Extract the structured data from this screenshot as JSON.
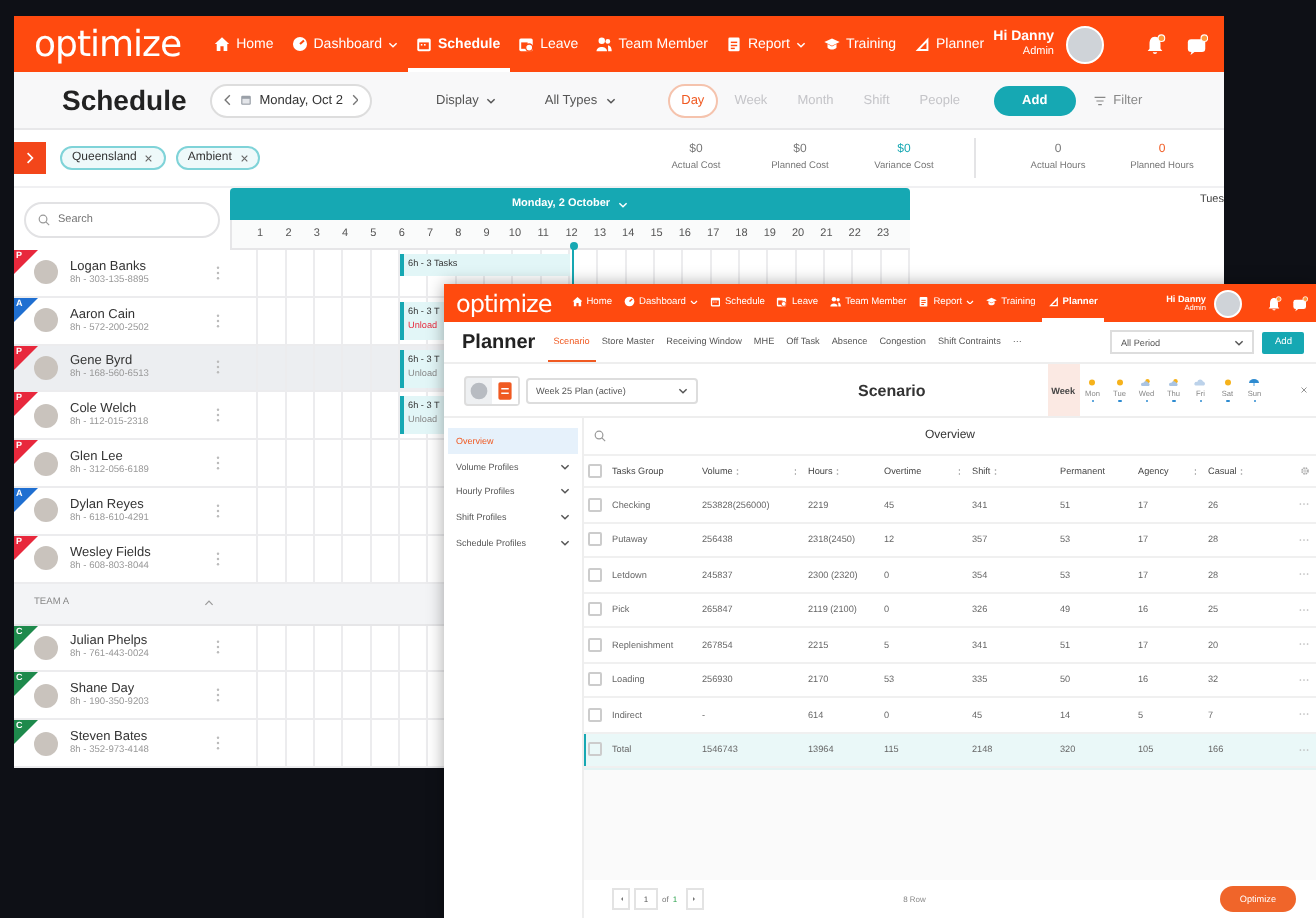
{
  "schedule_window": {
    "nav": {
      "logo": "optimize",
      "items": [
        {
          "label": "Home",
          "kind": "home",
          "dropdown": false,
          "selected": false
        },
        {
          "label": "Dashboard",
          "kind": "dashboard",
          "dropdown": true,
          "selected": false
        },
        {
          "label": "Schedule",
          "kind": "schedule",
          "dropdown": false,
          "selected": true
        },
        {
          "label": "Leave",
          "kind": "leave",
          "dropdown": false,
          "selected": false
        },
        {
          "label": "Team Member",
          "kind": "team",
          "dropdown": false,
          "selected": false
        },
        {
          "label": "Report",
          "kind": "report",
          "dropdown": true,
          "selected": false
        },
        {
          "label": "Training",
          "kind": "training",
          "dropdown": false,
          "selected": false
        },
        {
          "label": "Planner",
          "kind": "planner",
          "dropdown": false,
          "selected": false
        }
      ],
      "user": {
        "greeting": "Hi Danny",
        "role": "Admin"
      }
    },
    "title": "Schedule",
    "date": "Monday, Oct 2",
    "display": "Display",
    "types": "All Types",
    "views": [
      {
        "label": "Day",
        "selected": true
      },
      {
        "label": "Week",
        "selected": false
      },
      {
        "label": "Month",
        "selected": false
      },
      {
        "label": "Shift",
        "selected": false
      },
      {
        "label": "People",
        "selected": false
      }
    ],
    "add": "Add",
    "filter": "Filter",
    "chips": [
      "Queensland",
      "Ambient"
    ],
    "stats": [
      {
        "value": "$0",
        "label": "Actual Cost",
        "kind": "plain"
      },
      {
        "value": "$0",
        "label": "Planned Cost",
        "kind": "plain"
      },
      {
        "value": "$0",
        "label": "Variance Cost",
        "kind": "accent"
      },
      {
        "value": "0",
        "label": "Actual Hours",
        "kind": "plain"
      },
      {
        "value": "0",
        "label": "Planned Hours",
        "kind": "warning"
      }
    ],
    "search": {
      "placeholder": "Search"
    },
    "day_header": "Monday, 2 October",
    "next_day": "Tues",
    "hours": [
      "1",
      "2",
      "3",
      "4",
      "5",
      "6",
      "7",
      "8",
      "9",
      "10",
      "11",
      "12",
      "13",
      "14",
      "15",
      "16",
      "17",
      "18",
      "19",
      "20",
      "21",
      "22",
      "23"
    ],
    "people": [
      {
        "kind": "person",
        "name": "Logan Banks",
        "info": "8h - 303-135-8895",
        "badge": "P",
        "color": "#e8283c",
        "selected": false,
        "task": {
          "title": "6h - 3 Tasks"
        }
      },
      {
        "kind": "person",
        "name": "Aaron Cain",
        "info": "8h - 572-200-2502",
        "badge": "A",
        "color": "#1f6fd1",
        "selected": false,
        "task": {
          "title": "6h - 3 T",
          "detail": "Unload",
          "warning": true
        }
      },
      {
        "kind": "person",
        "name": "Gene Byrd",
        "info": "8h - 168-560-6513",
        "badge": "P",
        "color": "#e8283c",
        "selected": true,
        "task": {
          "title": "6h - 3 T",
          "detail": "Unload",
          "warning": false
        }
      },
      {
        "kind": "person",
        "name": "Cole Welch",
        "info": "8h - 112-015-2318",
        "badge": "P",
        "color": "#e8283c",
        "selected": false,
        "task": {
          "title": "6h - 3 T",
          "detail": "Unload",
          "warning": false
        }
      },
      {
        "kind": "person",
        "name": "Glen Lee",
        "info": "8h - 312-056-6189",
        "badge": "P",
        "color": "#e8283c",
        "selected": false
      },
      {
        "kind": "person",
        "name": "Dylan Reyes",
        "info": "8h - 618-610-4291",
        "badge": "A",
        "color": "#1f6fd1",
        "selected": false
      },
      {
        "kind": "person",
        "name": "Wesley Fields",
        "info": "8h - 608-803-8044",
        "badge": "P",
        "color": "#e8283c",
        "selected": false
      },
      {
        "kind": "team",
        "name": "TEAM A",
        "expanded": true
      },
      {
        "kind": "person",
        "name": "Julian Phelps",
        "info": "8h - 761-443-0024",
        "badge": "C",
        "color": "#1e8a4c",
        "selected": false
      },
      {
        "kind": "person",
        "name": "Shane Day",
        "info": "8h - 190-350-9203",
        "badge": "C",
        "color": "#1e8a4c",
        "selected": false
      },
      {
        "kind": "person",
        "name": "Steven Bates",
        "info": "8h - 352-973-4148",
        "badge": "C",
        "color": "#1e8a4c",
        "selected": false
      }
    ]
  },
  "planner_window": {
    "nav": {
      "logo": "optimize",
      "items": [
        {
          "label": "Home",
          "kind": "home",
          "dropdown": false,
          "selected": false
        },
        {
          "label": "Dashboard",
          "kind": "dashboard",
          "dropdown": true,
          "selected": false
        },
        {
          "label": "Schedule",
          "kind": "schedule",
          "dropdown": false,
          "selected": false
        },
        {
          "label": "Leave",
          "kind": "leave",
          "dropdown": false,
          "selected": false
        },
        {
          "label": "Team Member",
          "kind": "team",
          "dropdown": false,
          "selected": false
        },
        {
          "label": "Report",
          "kind": "report",
          "dropdown": true,
          "selected": false
        },
        {
          "label": "Training",
          "kind": "training",
          "dropdown": false,
          "selected": false
        },
        {
          "label": "Planner",
          "kind": "planner",
          "dropdown": false,
          "selected": true
        }
      ],
      "user": {
        "greeting": "Hi Danny",
        "role": "Admin"
      }
    },
    "title": "Planner",
    "tabs": [
      {
        "label": "Scenario",
        "selected": true
      },
      {
        "label": "Store Master",
        "selected": false
      },
      {
        "label": "Receiving Window",
        "selected": false
      },
      {
        "label": "MHE",
        "selected": false
      },
      {
        "label": "Off Task",
        "selected": false
      },
      {
        "label": "Absence",
        "selected": false
      },
      {
        "label": "Congestion",
        "selected": false
      },
      {
        "label": "Shift Contraints",
        "selected": false
      }
    ],
    "more": "···",
    "period": "All Period",
    "add": "Add",
    "view_toggle": [
      {
        "kind": "gauge",
        "selected": false
      },
      {
        "kind": "document",
        "selected": true
      }
    ],
    "plan": "Week 25 Plan (active)",
    "heading": "Scenario",
    "week": {
      "label": "Week",
      "selected": true
    },
    "days": [
      {
        "label": "Mon",
        "kind": "sunny"
      },
      {
        "label": "Tue",
        "kind": "sunny"
      },
      {
        "label": "Wed",
        "kind": "partly"
      },
      {
        "label": "Thu",
        "kind": "partly"
      },
      {
        "label": "Fri",
        "kind": "cloudy"
      },
      {
        "label": "Sat",
        "kind": "sunny"
      },
      {
        "label": "Sun",
        "kind": "rain"
      }
    ],
    "sidebar": [
      {
        "label": "Overview",
        "selected": true,
        "expandable": false
      },
      {
        "label": "Volume Profiles",
        "selected": false,
        "expandable": true
      },
      {
        "label": "Hourly Profiles",
        "selected": false,
        "expandable": true
      },
      {
        "label": "Shift Profiles",
        "selected": false,
        "expandable": true
      },
      {
        "label": "Schedule Profiles",
        "selected": false,
        "expandable": true
      }
    ],
    "section_title": "Overview",
    "table": {
      "header_checked": false,
      "columns": [
        {
          "label": "Tasks Group",
          "sortable": false,
          "resizable": false
        },
        {
          "label": "Volume",
          "sortable": true,
          "resizable": true
        },
        {
          "label": "Hours",
          "sortable": true,
          "resizable": false
        },
        {
          "label": "Overtime",
          "sortable": false,
          "resizable": true
        },
        {
          "label": "Shift",
          "sortable": true,
          "resizable": false
        },
        {
          "label": "Permanent",
          "sortable": false,
          "resizable": false
        },
        {
          "label": "Agency",
          "sortable": false,
          "resizable": true
        },
        {
          "label": "Casual",
          "sortable": true,
          "resizable": false
        }
      ],
      "rows": [
        {
          "cells": [
            "Checking",
            "253828(256000)",
            "2219",
            "45",
            "341",
            "51",
            "17",
            "26"
          ],
          "checked": false,
          "selected": false
        },
        {
          "cells": [
            "Putaway",
            "256438",
            "2318(2450)",
            "12",
            "357",
            "53",
            "17",
            "28"
          ],
          "checked": false,
          "selected": false
        },
        {
          "cells": [
            "Letdown",
            "245837",
            "2300 (2320)",
            "0",
            "354",
            "53",
            "17",
            "28"
          ],
          "checked": false,
          "selected": false
        },
        {
          "cells": [
            "Pick",
            "265847",
            "2119 (2100)",
            "0",
            "326",
            "49",
            "16",
            "25"
          ],
          "checked": false,
          "selected": false
        },
        {
          "cells": [
            "Replenishment",
            "267854",
            "2215",
            "5",
            "341",
            "51",
            "17",
            "20"
          ],
          "checked": false,
          "selected": false
        },
        {
          "cells": [
            "Loading",
            "256930",
            "2170",
            "53",
            "335",
            "50",
            "16",
            "32"
          ],
          "checked": false,
          "selected": false
        },
        {
          "cells": [
            "Indirect",
            "-",
            "614",
            "0",
            "45",
            "14",
            "5",
            "7"
          ],
          "checked": false,
          "selected": false
        },
        {
          "cells": [
            "Total",
            "1546743",
            "13964",
            "115",
            "2148",
            "320",
            "105",
            "166"
          ],
          "checked": false,
          "selected": true
        }
      ]
    },
    "pagination": {
      "page": "1",
      "of": "of",
      "total": "1"
    },
    "row_count": "8 Row",
    "optimize": "Optimize"
  }
}
